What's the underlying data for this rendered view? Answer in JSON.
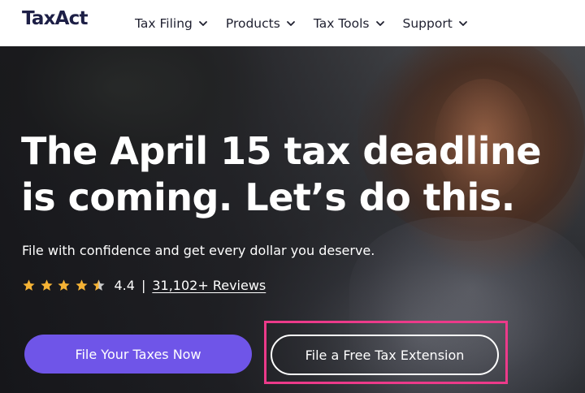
{
  "header": {
    "logo": "TaxAct",
    "nav": [
      {
        "label": "Tax Filing",
        "icon": "chevron-down-icon"
      },
      {
        "label": "Products",
        "icon": "chevron-down-icon"
      },
      {
        "label": "Tax Tools",
        "icon": "chevron-down-icon"
      },
      {
        "label": "Support",
        "icon": "chevron-down-icon"
      }
    ]
  },
  "hero": {
    "headline_line1": "The April 15 tax deadline",
    "headline_line2": "is coming. Let’s do this.",
    "subhead": "File with confidence and get every dollar you deserve.",
    "rating": {
      "stars": 4.4,
      "value_text": "4.4",
      "separator": "|",
      "reviews_label": "31,102+ Reviews",
      "star_color": "#f5b335"
    },
    "primary_button": "File Your Taxes Now",
    "secondary_button": "File a Free Tax Extension"
  },
  "colors": {
    "brand_navy": "#1d1f46",
    "primary_button": "#6f55e8",
    "highlight_box": "#ec3a8a"
  }
}
